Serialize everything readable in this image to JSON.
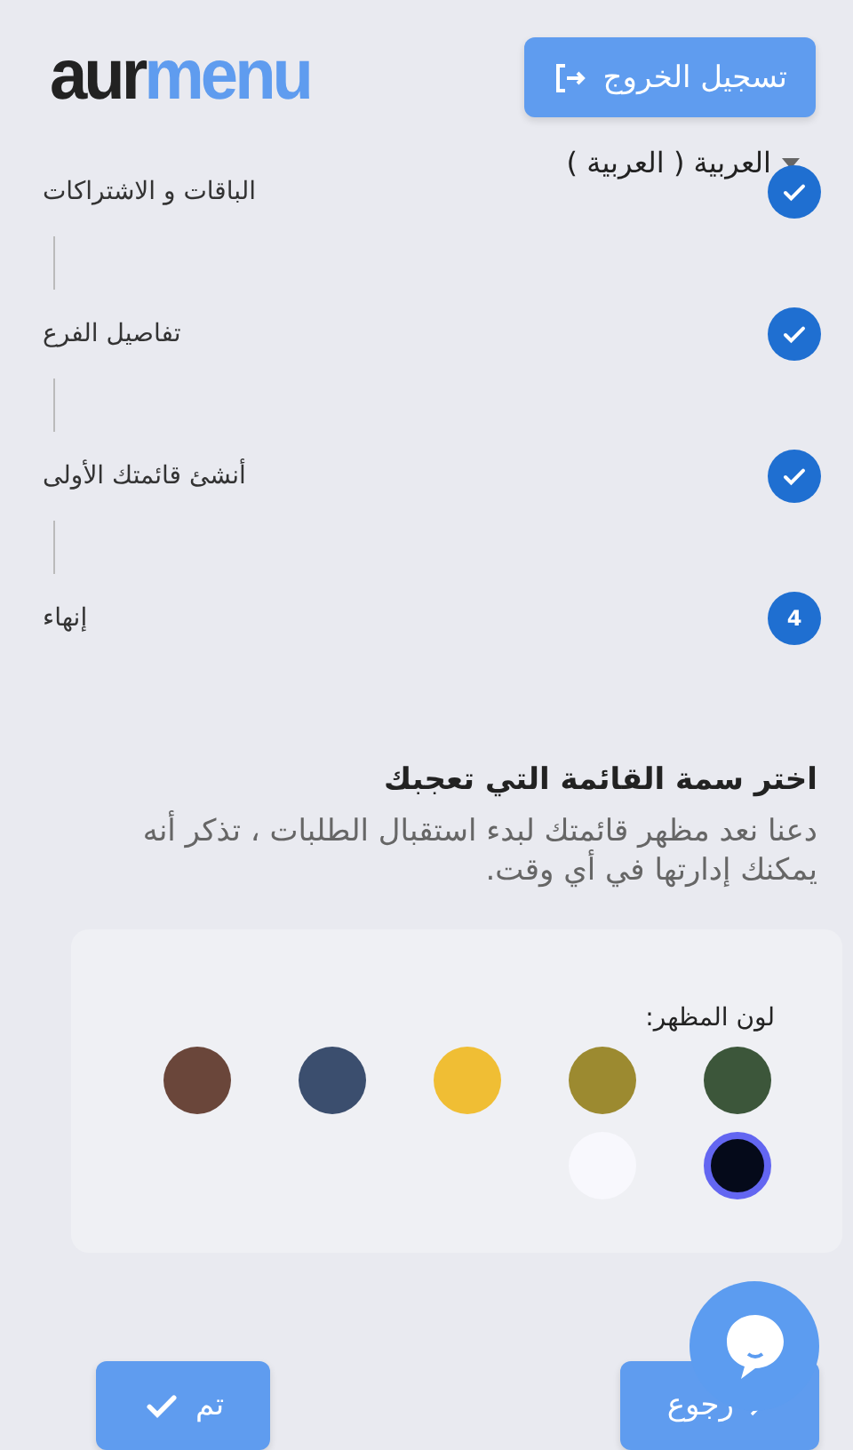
{
  "header": {
    "logo": {
      "part_1": "aur",
      "part_2": "menu"
    },
    "logout_button": "تسجيل الخروج",
    "language": "العربية ( العربية )"
  },
  "steps": [
    {
      "label": "الباقات و الاشتراكات",
      "done": true
    },
    {
      "label": "تفاصيل الفرع",
      "done": true
    },
    {
      "label": "أنشئ قائمتك الأولى",
      "done": true
    },
    {
      "label": "إنهاء",
      "done": false,
      "number": "4"
    }
  ],
  "theme": {
    "title": "اختر سمة القائمة التي تعجبك",
    "description": "دعنا نعد مظهر قائمتك لبدء استقبال الطلبات ، تذكر أنه يمكنك إدارتها في أي وقت.",
    "color_label": "لون المظهر:",
    "colors": [
      {
        "color": "#3c563a",
        "selected": false
      },
      {
        "color": "#9c8a30",
        "selected": false
      },
      {
        "color": "#f0be34",
        "selected": false
      },
      {
        "color": "#3b4e6e",
        "selected": false
      },
      {
        "color": "#6a463a",
        "selected": false
      },
      {
        "color": "#050a1a",
        "selected": true
      },
      {
        "color": "#f8f8fd",
        "selected": false
      }
    ]
  },
  "footer": {
    "back_button": "رجوع",
    "done_button": "تم"
  }
}
